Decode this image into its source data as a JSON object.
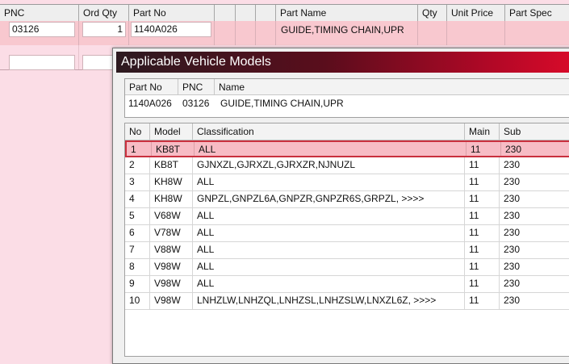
{
  "grid": {
    "columns": [
      "PNC",
      "Ord Qty",
      "Part No",
      "",
      "",
      "",
      "Part Name",
      "Qty",
      "Unit Price",
      "Part Spec"
    ],
    "row1": {
      "pnc": "03126",
      "ord_qty": "1",
      "part_no": "1140A026",
      "part_name": "GUIDE,TIMING CHAIN,UPR"
    },
    "row2": {
      "pnc": "",
      "ord_qty": ""
    }
  },
  "dialog": {
    "title": "Applicable Vehicle Models",
    "info_headers": [
      "Part No",
      "PNC",
      "Name"
    ],
    "info_values": {
      "part_no": "1140A026",
      "pnc": "03126",
      "name": "GUIDE,TIMING CHAIN,UPR"
    },
    "table_headers": [
      "No",
      "Model",
      "Classification",
      "Main",
      "Sub"
    ],
    "rows": [
      {
        "no": "1",
        "model": "KB8T",
        "classification": "ALL",
        "main": "11",
        "sub": "230"
      },
      {
        "no": "2",
        "model": "KB8T",
        "classification": "GJNXZL,GJRXZL,GJRXZR,NJNUZL",
        "main": "11",
        "sub": "230"
      },
      {
        "no": "3",
        "model": "KH8W",
        "classification": "ALL",
        "main": "11",
        "sub": "230"
      },
      {
        "no": "4",
        "model": "KH8W",
        "classification": "GNPZL,GNPZL6A,GNPZR,GNPZR6S,GRPZL,   >>>>",
        "main": "11",
        "sub": "230"
      },
      {
        "no": "5",
        "model": "V68W",
        "classification": "ALL",
        "main": "11",
        "sub": "230"
      },
      {
        "no": "6",
        "model": "V78W",
        "classification": "ALL",
        "main": "11",
        "sub": "230"
      },
      {
        "no": "7",
        "model": "V88W",
        "classification": "ALL",
        "main": "11",
        "sub": "230"
      },
      {
        "no": "8",
        "model": "V98W",
        "classification": "ALL",
        "main": "11",
        "sub": "230"
      },
      {
        "no": "9",
        "model": "V98W",
        "classification": "ALL",
        "main": "11",
        "sub": "230"
      },
      {
        "no": "10",
        "model": "V98W",
        "classification": "LNHZLW,LNHZQL,LNHZSL,LNHZSLW,LNXZL6Z,   >>>>",
        "main": "11",
        "sub": "230"
      }
    ],
    "selected_row": 1
  },
  "colors": {
    "background": "#fbdde6",
    "selected_row": "#f7bcc5",
    "selected_border": "#c9303e",
    "title_gradient_end": "#dc0a2a"
  }
}
